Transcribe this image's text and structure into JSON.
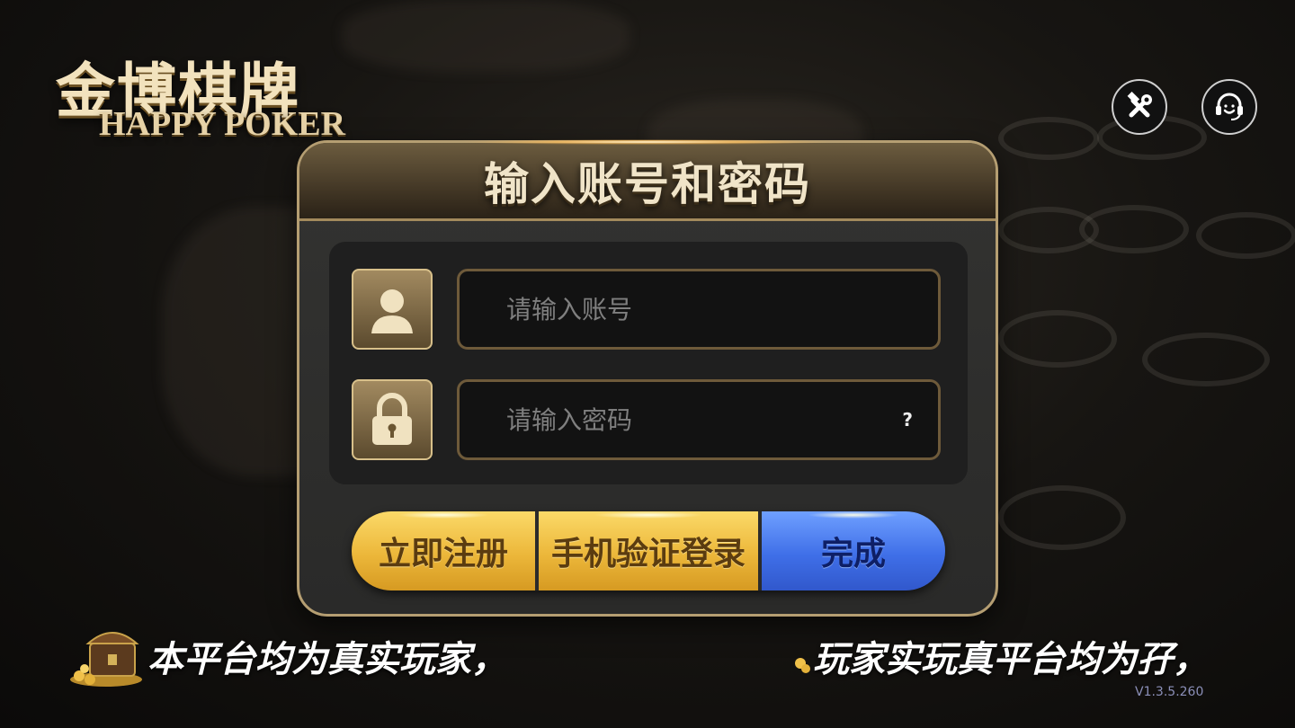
{
  "logo": {
    "title_cn": "金博棋牌",
    "title_en": "HAPPY POKER"
  },
  "top_icons": {
    "settings": "tools-icon",
    "support": "headset-icon"
  },
  "dialog": {
    "title": "输入账号和密码",
    "account_placeholder": "请输入账号",
    "password_placeholder": "请输入密码",
    "help_label": "?"
  },
  "buttons": {
    "register": "立即注册",
    "phone_login": "手机验证登录",
    "done": "完成"
  },
  "ticker": {
    "left": "本平台均为真实玩家，",
    "right": "玩家实玩真平台均为孖，"
  },
  "version": "V1.3.5.260",
  "colors": {
    "gold_button": "#ecb73a",
    "blue_button": "#3f6fe8",
    "dialog_border": "#b59e72"
  }
}
